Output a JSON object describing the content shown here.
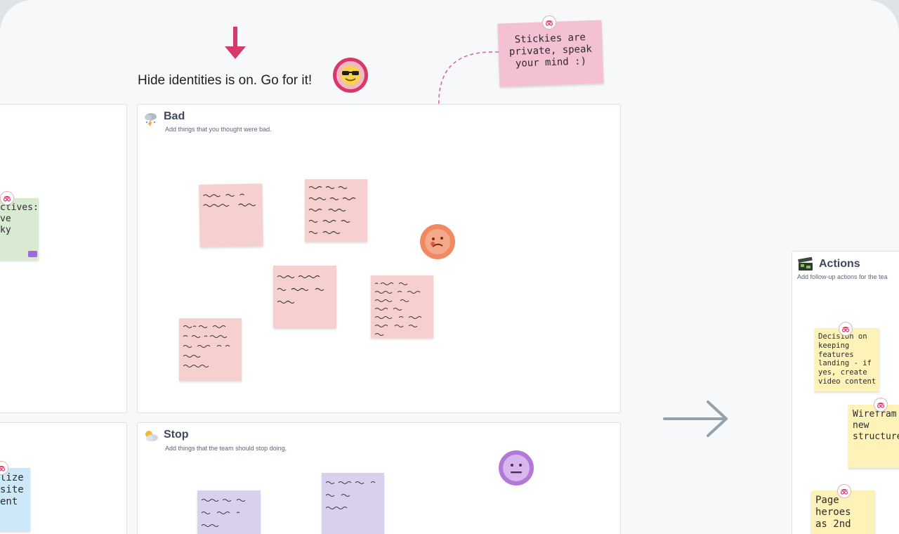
{
  "board": {
    "headline": "Hide identities is on. Go for it!",
    "note": "Stickies are\nprivate, speak\nyour mind :)"
  },
  "frames": {
    "bad": {
      "title": "Bad",
      "subtitle": "Add things that you thought were bad."
    },
    "stop": {
      "title": "Stop",
      "subtitle": "Add things that the team should stop doing."
    },
    "actions": {
      "title": "Actions",
      "subtitle": "Add follow-up actions for the tea"
    }
  },
  "stickies": {
    "left_green": "ctives:\nve\nky",
    "left_blue": "lize\nsite\nent",
    "action_1": "Decision on\nkeeping\nfeatures\nlanding - if\nyes, create\nvideo content",
    "action_2": "Wirefram\nnew\nstructure",
    "action_3": "Page\nheroes\nas 2nd"
  },
  "icons": {
    "arrow_down": "arrow-down-icon",
    "arrow_right": "arrow-right-icon",
    "sunglasses_emoji": "sunglasses-emoji-icon",
    "sad_emoji": "sad-emoji-icon",
    "neutral_emoji": "neutral-emoji-icon",
    "hidden_identity": "incognito-icon",
    "weather_storm": "storm-cloud-icon",
    "weather_sun": "sun-cloud-icon",
    "clapper": "clapperboard-icon"
  },
  "colors": {
    "accent_pink": "#d9386a",
    "note_pink": "#f3c0d4",
    "sticky_pink": "#f6cfcf",
    "sticky_lilac": "#d8d0ec",
    "sticky_yellow": "#fdf3b8",
    "sticky_green": "#d9ead3",
    "sticky_blue": "#cde8f8",
    "arrow_gray": "#93a2ac"
  }
}
